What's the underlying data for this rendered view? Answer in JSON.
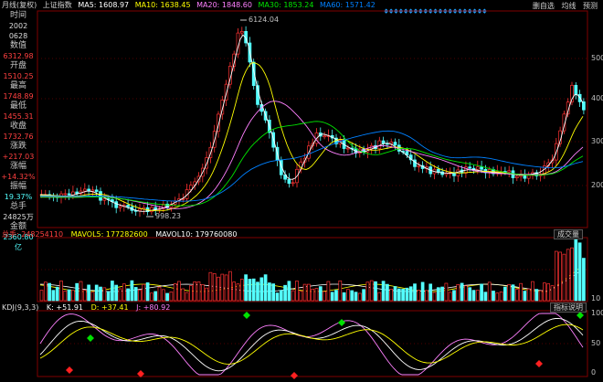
{
  "header": {
    "title": "月线(复权)",
    "index": "上证指数",
    "ma5": "MA5: 1608.97",
    "ma10": "MA10: 1638.45",
    "ma20": "MA20: 1848.60",
    "ma30": "MA30: 1853.24",
    "ma60": "MA60: 1571.42"
  },
  "toolbar": {
    "mobile": "删自选",
    "ma_window": "均线",
    "forecast": "预测"
  },
  "sidebar": {
    "time_label": "时间",
    "time_year": "2002",
    "time_date": "0628",
    "value_label": "数值",
    "value": "6312.98",
    "open_label": "开盘",
    "open": "1510.25",
    "high_label": "最高",
    "high": "1748.89",
    "low_label": "最低",
    "low": "1455.31",
    "close_label": "收盘",
    "close": "1732.76",
    "change_label": "涨跌",
    "change": "+217.03",
    "pct_label": "涨幅",
    "pct": "+14.32%",
    "amp_label": "振幅",
    "amp": "19.37%",
    "vol_label": "总手",
    "vol": "24825万",
    "amt_label": "金额",
    "amt": "2360.80亿"
  },
  "price_axis": [
    "5000",
    "4000",
    "3000",
    "2000"
  ],
  "price_annotations": {
    "high": "6124.04",
    "low": "998.23"
  },
  "volume_panel": {
    "total": "总手: 248254110",
    "mavol5": "MAVOL5: 177282600",
    "mavol10": "MAVOL10: 179760080",
    "button": "成交量",
    "axis": [
      "",
      "10"
    ]
  },
  "kdj_panel": {
    "label": "KDJ(9,3,3)",
    "k": "K: +51.91",
    "d": "D: +37.41",
    "j": "J: +80.92",
    "button": "指标说明",
    "axis": [
      "100",
      "50",
      "0"
    ]
  },
  "colors": {
    "up": "#ff3232",
    "down": "#54ffff",
    "ma5": "#ffffff",
    "ma10": "#ffff00",
    "ma20": "#ff80ff",
    "ma30": "#00e600",
    "ma60": "#0080ff"
  }
}
